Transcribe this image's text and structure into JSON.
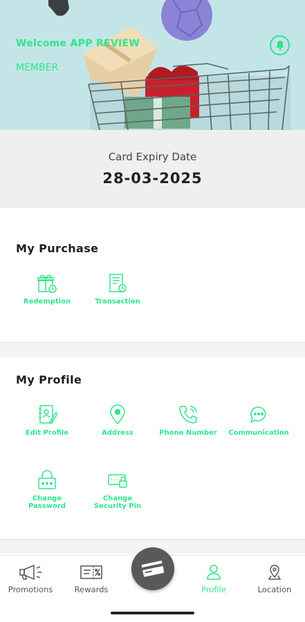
{
  "header": {
    "welcome": "Welcome APP REVIEW",
    "member_tier": "MEMBER",
    "bell_icon": "bell-icon"
  },
  "card": {
    "expiry_label": "Card Expiry Date",
    "expiry_date": "28-03-2025"
  },
  "purchase": {
    "title": "My Purchase",
    "items": [
      {
        "label": "Redemption",
        "icon": "gift-clock-icon"
      },
      {
        "label": "Transaction",
        "icon": "receipt-clock-icon"
      }
    ]
  },
  "profile": {
    "title": "My Profile",
    "items": [
      {
        "label": "Edit Profile",
        "icon": "edit-profile-icon"
      },
      {
        "label": "Address",
        "icon": "location-pin-icon"
      },
      {
        "label": "Phone Number",
        "icon": "phone-icon"
      },
      {
        "label": "Communication",
        "icon": "chat-icon"
      },
      {
        "label": "Change\nPassword",
        "icon": "lock-icon"
      },
      {
        "label": "Change\nSecurity Pin",
        "icon": "pin-card-icon"
      }
    ]
  },
  "bottom_nav": {
    "items": [
      {
        "label": "Promotions",
        "icon": "megaphone-icon"
      },
      {
        "label": "Rewards",
        "icon": "voucher-icon"
      },
      {
        "label": "Profile",
        "icon": "person-icon"
      },
      {
        "label": "Location",
        "icon": "location-icon"
      }
    ],
    "active": "Profile",
    "center_icon": "card-icon"
  },
  "colors": {
    "accent": "#2ee58a",
    "hero_bg": "#c4e5e8",
    "center_button": "#595959"
  }
}
